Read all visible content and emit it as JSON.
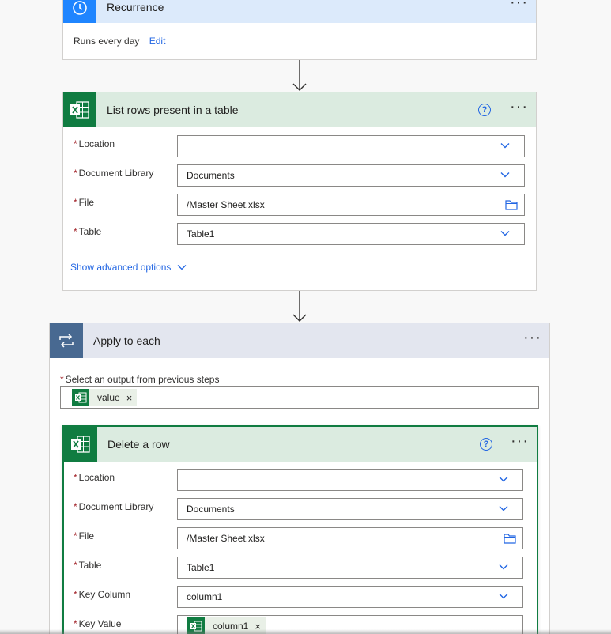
{
  "recurrence": {
    "title": "Recurrence",
    "summary": "Runs every day",
    "edit_label": "Edit",
    "more": "···"
  },
  "list_rows": {
    "title": "List rows present in a table",
    "help": "?",
    "more": "···",
    "fields": [
      {
        "label": "Location",
        "value": ""
      },
      {
        "label": "Document Library",
        "value": "Documents"
      },
      {
        "label": "File",
        "value": "/Master Sheet.xlsx"
      },
      {
        "label": "Table",
        "value": "Table1"
      }
    ],
    "advanced_label": "Show advanced options"
  },
  "apply_each": {
    "title": "Apply to each",
    "more": "···",
    "select_label": "Select an output from previous steps",
    "token": "value",
    "token_remove": "×"
  },
  "delete_row": {
    "title": "Delete a row",
    "help": "?",
    "more": "···",
    "fields": [
      {
        "label": "Location",
        "value": ""
      },
      {
        "label": "Document Library",
        "value": "Documents"
      },
      {
        "label": "File",
        "value": "/Master Sheet.xlsx"
      },
      {
        "label": "Table",
        "value": "Table1"
      },
      {
        "label": "Key Column",
        "value": "column1"
      },
      {
        "label": "Key Value",
        "token": "column1",
        "token_remove": "×"
      }
    ]
  },
  "required_mark": "*",
  "colors": {
    "recurrence_header": "#dceafb",
    "recurrence_icon": "#1f85ff",
    "excel_header": "#dbebe0",
    "excel_icon": "#107c41",
    "apply_header": "#e3e6ef",
    "apply_icon": "#486991",
    "link": "#2266e3"
  }
}
